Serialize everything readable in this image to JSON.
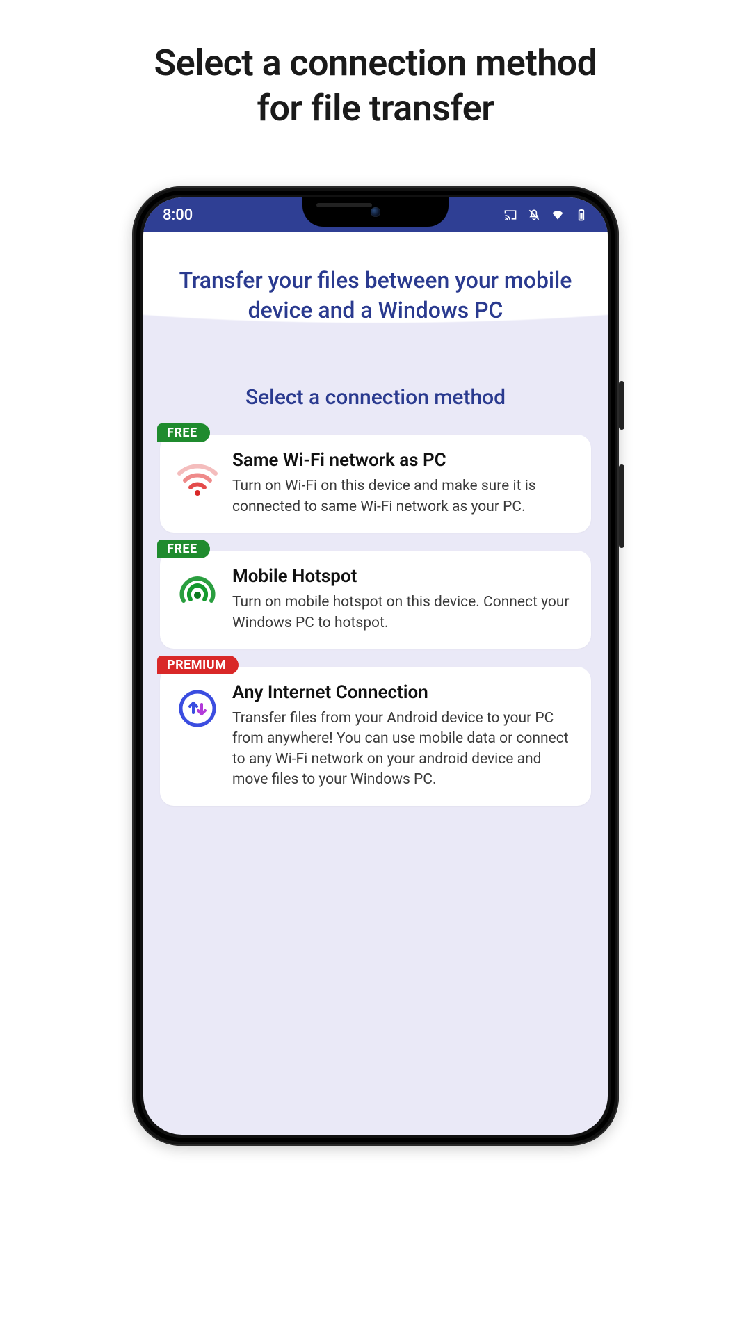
{
  "page": {
    "title_line1": "Select a connection method",
    "title_line2": "for file transfer"
  },
  "status_bar": {
    "time": "8:00"
  },
  "app": {
    "header_text": "Transfer your files between your mobile device and a Windows PC",
    "section_title": "Select a connection method"
  },
  "badges": {
    "free": "FREE",
    "premium": "PREMIUM"
  },
  "cards": [
    {
      "badge": "free",
      "title": "Same Wi-Fi network as PC",
      "description": "Turn on Wi-Fi on this device and make sure it is connected to same Wi-Fi network as your PC."
    },
    {
      "badge": "free",
      "title": "Mobile Hotspot",
      "description": "Turn on mobile hotspot on this device. Connect your Windows PC to hotspot."
    },
    {
      "badge": "premium",
      "title": "Any Internet Connection",
      "description": "Transfer files from your Android device to your PC from anywhere! You can use mobile data or connect to any Wi-Fi network on your android device and move files to your Windows PC."
    }
  ]
}
